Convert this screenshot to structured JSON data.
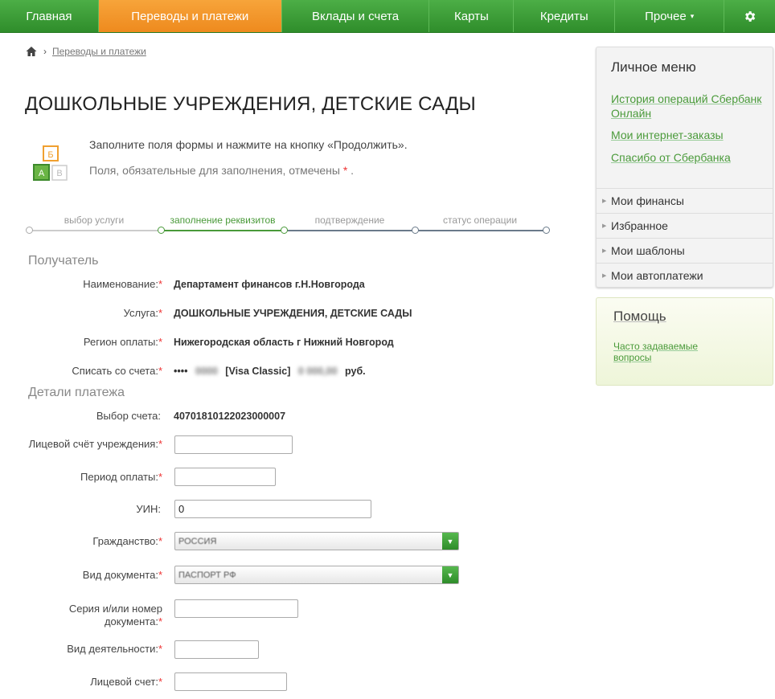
{
  "nav": {
    "items": [
      {
        "label": "Главная"
      },
      {
        "label": "Переводы и платежи"
      },
      {
        "label": "Вклады и счета"
      },
      {
        "label": "Карты"
      },
      {
        "label": "Кредиты"
      },
      {
        "label": "Прочее"
      }
    ]
  },
  "breadcrumb": {
    "link": "Переводы и платежи"
  },
  "page_title": "ДОШКОЛЬНЫЕ УЧРЕЖДЕНИЯ, ДЕТСКИЕ САДЫ",
  "intro": {
    "line1": "Заполните поля формы и нажмите на кнопку «Продолжить».",
    "line2": "Поля, обязательные для заполнения, отмечены",
    "mark": "*",
    "dot": ".",
    "icon_letters": [
      "Б",
      "А",
      "В"
    ]
  },
  "steps": [
    {
      "label": "выбор услуги"
    },
    {
      "label": "заполнение реквизитов"
    },
    {
      "label": "подтверждение"
    },
    {
      "label": "статус операции"
    }
  ],
  "recipient": {
    "title": "Получатель",
    "rows": [
      {
        "label": "Наименование:",
        "value": "Департамент финансов г.Н.Новгорода"
      },
      {
        "label": "Услуга:",
        "value": "ДОШКОЛЬНЫЕ УЧРЕЖДЕНИЯ, ДЕТСКИЕ САДЫ"
      },
      {
        "label": "Регион оплаты:",
        "value": "Нижегородская область г Нижний Новгород"
      },
      {
        "label": "Списать со счета:",
        "value_prefix": "••••",
        "value_hidden1": "0000",
        "value_card": "[Visa Classic]",
        "value_hidden2": "0 000,00",
        "value_suffix": "руб."
      }
    ]
  },
  "details": {
    "title": "Детали платежа",
    "account_label": "Выбор счета:",
    "account_value": "40701810122023000007",
    "fields": [
      {
        "label": "Лицевой счёт учреждения:",
        "value": ""
      },
      {
        "label": "Период оплаты:",
        "value": ""
      },
      {
        "label": "УИН:",
        "value": "0"
      },
      {
        "label": "Гражданство:",
        "value": "РОССИЯ"
      },
      {
        "label": "Вид документа:",
        "value": "ПАСПОРТ РФ"
      },
      {
        "label": "Серия и/или номер",
        "label2": "документа:",
        "value": ""
      },
      {
        "label": "Вид деятельности:",
        "value": ""
      },
      {
        "label": "Лицевой счет:",
        "value": ""
      }
    ],
    "required_mark": "*"
  },
  "sidebar": {
    "title": "Личное меню",
    "links": [
      {
        "line1": "История операций Сбербанк",
        "line2": "Онлайн"
      },
      {
        "line1": "Мои интернет-заказы"
      },
      {
        "line1": "Спасибо от Сбербанка"
      }
    ],
    "items": [
      {
        "label": "Мои финансы"
      },
      {
        "label": "Избранное"
      },
      {
        "label": "Мои шаблоны"
      },
      {
        "label": "Мои автоплатежи"
      }
    ]
  },
  "help": {
    "title": "Помощь",
    "link_line1": "Часто задаваемые",
    "link_line2": "вопросы"
  },
  "colors": {
    "nav_green": "#3fa03a",
    "nav_active_orange": "#f39a2e",
    "link_green": "#4a9a3a",
    "required_red": "#ee3333"
  }
}
